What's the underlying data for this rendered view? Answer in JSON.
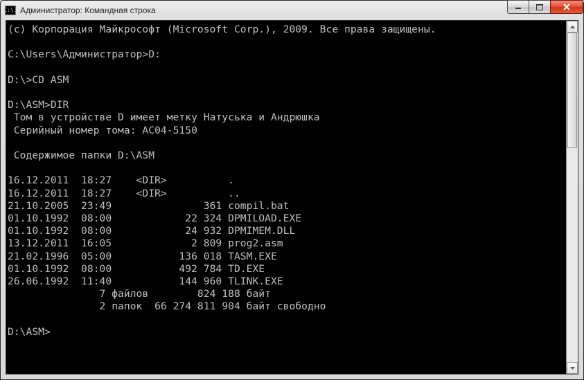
{
  "window": {
    "title": "Администратор: Командная строка",
    "icon_text": "C:\\."
  },
  "console": {
    "copyright": "(c) Корпорация Майкрософт (Microsoft Corp.), 2009. Все права защищены.",
    "blank": "",
    "prompt1": "C:\\Users\\Администратор>D:",
    "prompt2": "D:\\>CD ASM",
    "prompt3": "D:\\ASM>DIR",
    "vol_label": " Том в устройстве D имеет метку Натуська и Андрюшка",
    "vol_serial": " Серийный номер тома: AC04-5150",
    "dir_header": " Содержимое папки D:\\ASM",
    "rows": [
      "16.12.2011  18:27    <DIR>          .",
      "16.12.2011  18:27    <DIR>          ..",
      "21.10.2005  23:49               361 compil.bat",
      "01.10.1992  08:00            22 324 DPMILOAD.EXE",
      "01.10.1992  08:00            24 932 DPMIMEM.DLL",
      "13.12.2011  16:05             2 809 prog2.asm",
      "21.02.1996  05:00           136 018 TASM.EXE",
      "01.10.1992  08:00           492 784 TD.EXE",
      "26.06.1992  11:40           144 960 TLINK.EXE"
    ],
    "summary_files": "               7 файлов        824 188 байт",
    "summary_dirs": "               2 папок  66 274 811 904 байт свободно",
    "prompt4": "D:\\ASM>"
  }
}
